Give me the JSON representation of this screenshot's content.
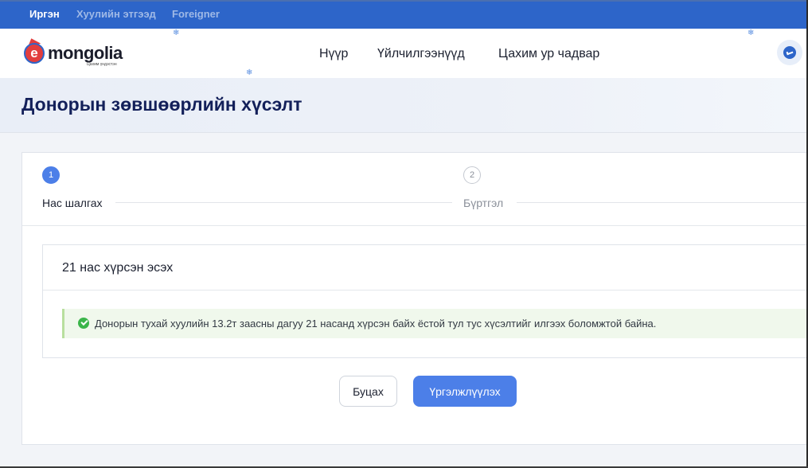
{
  "topbar": {
    "links": [
      {
        "label": "Иргэн",
        "active": true
      },
      {
        "label": "Хуулийн этгээд",
        "active": false
      },
      {
        "label": "Foreigner",
        "active": false
      }
    ]
  },
  "header": {
    "logo": {
      "letter": "e",
      "word": "mongolia",
      "tagline": "Цахим үндэстэн"
    },
    "nav": [
      "Нүүр",
      "Үйлчилгээнүүд",
      "Цахим ур чадвар"
    ],
    "chat_icon": "chat-bubble-icon"
  },
  "page": {
    "title": "Донорын зөвшөөрлийн хүсэлт"
  },
  "stepper": {
    "steps": [
      {
        "number": "1",
        "label": "Нас шалгах",
        "active": true
      },
      {
        "number": "2",
        "label": "Бүртгэл",
        "active": false
      }
    ]
  },
  "panel": {
    "title": "21 нас хүрсэн эсэх",
    "alert": {
      "icon": "check-circle-icon",
      "message": "Донорын тухай хуулийн 13.2т заасны дагуу 21 насанд хүрсэн байх ёстой тул тус хүсэлтийг илгээх боломжтой байна."
    }
  },
  "actions": {
    "back_label": "Буцах",
    "continue_label": "Үргэлжлүүлэх"
  },
  "colors": {
    "primary": "#4c7fe8",
    "topbar": "#2d65c9",
    "title": "#13205a",
    "success": "#3bb54a"
  }
}
